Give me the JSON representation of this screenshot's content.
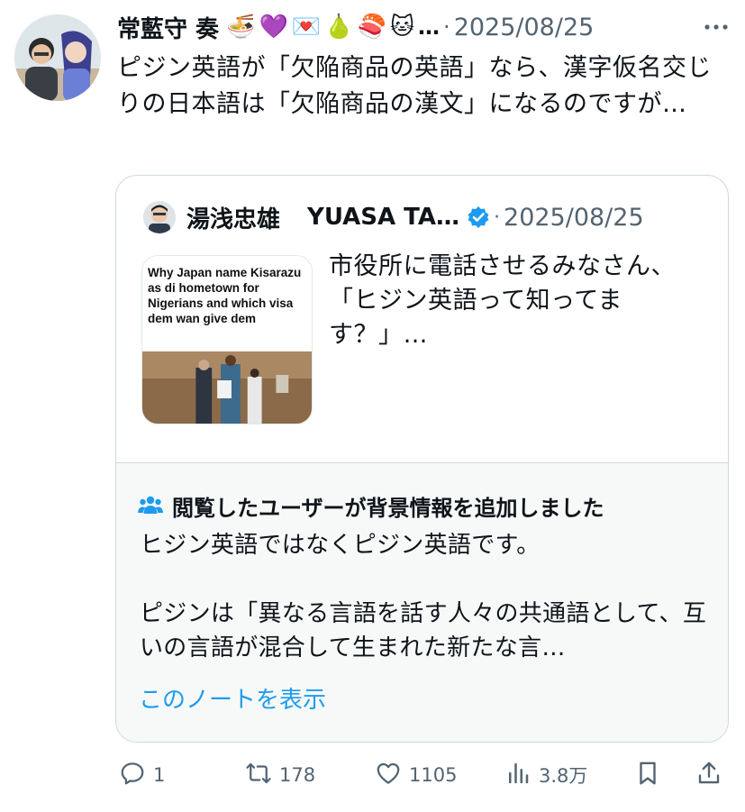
{
  "post": {
    "author_name": "常藍守 奏",
    "author_emojis": [
      "🍜",
      "💜",
      "💌",
      "🍐",
      "🍣",
      "🐱"
    ],
    "name_ellipsis": "…",
    "separator": "·",
    "date": "2025/08/25",
    "more_icon": "more-horizontal-icon",
    "text": "ピジン英語が「欠陥商品の英語」なら、漢字仮名交じりの日本語は「欠陥商品の漢文」になるのですが…"
  },
  "quote": {
    "author_name": "湯浅忠雄",
    "author_handle": "YUASA TA…",
    "verified_icon": "verified-badge-icon",
    "separator": "·",
    "date": "2025/08/25",
    "media_caption": "Why Japan name Kisarazu as di hometown for Nigerians and which visa dem wan give dem",
    "text_lines": [
      "市役所に電話させるみなさん、",
      "「ヒジン英語って知ってます？」…"
    ]
  },
  "note": {
    "icon": "people-icon",
    "heading": "閲覧したユーザーが背景情報を追加しました",
    "paragraph1": "ヒジン英語ではなくピジン英語です。",
    "paragraph2": "ピジンは「異なる言語を話す人々の共通語として、互いの言語が混合して生まれた新たな言…",
    "link": "このノートを表示"
  },
  "actions": {
    "reply_count": "1",
    "retweet_count": "178",
    "like_count": "1105",
    "views_count": "3.8万",
    "icons": [
      "reply-icon",
      "retweet-icon",
      "heart-icon",
      "views-icon",
      "bookmark-icon",
      "share-icon"
    ]
  },
  "colors": {
    "text": "#0f1419",
    "secondary": "#536471",
    "link": "#1d9bf0",
    "border": "#cfd9de",
    "note_bg": "#f7f9f9"
  }
}
